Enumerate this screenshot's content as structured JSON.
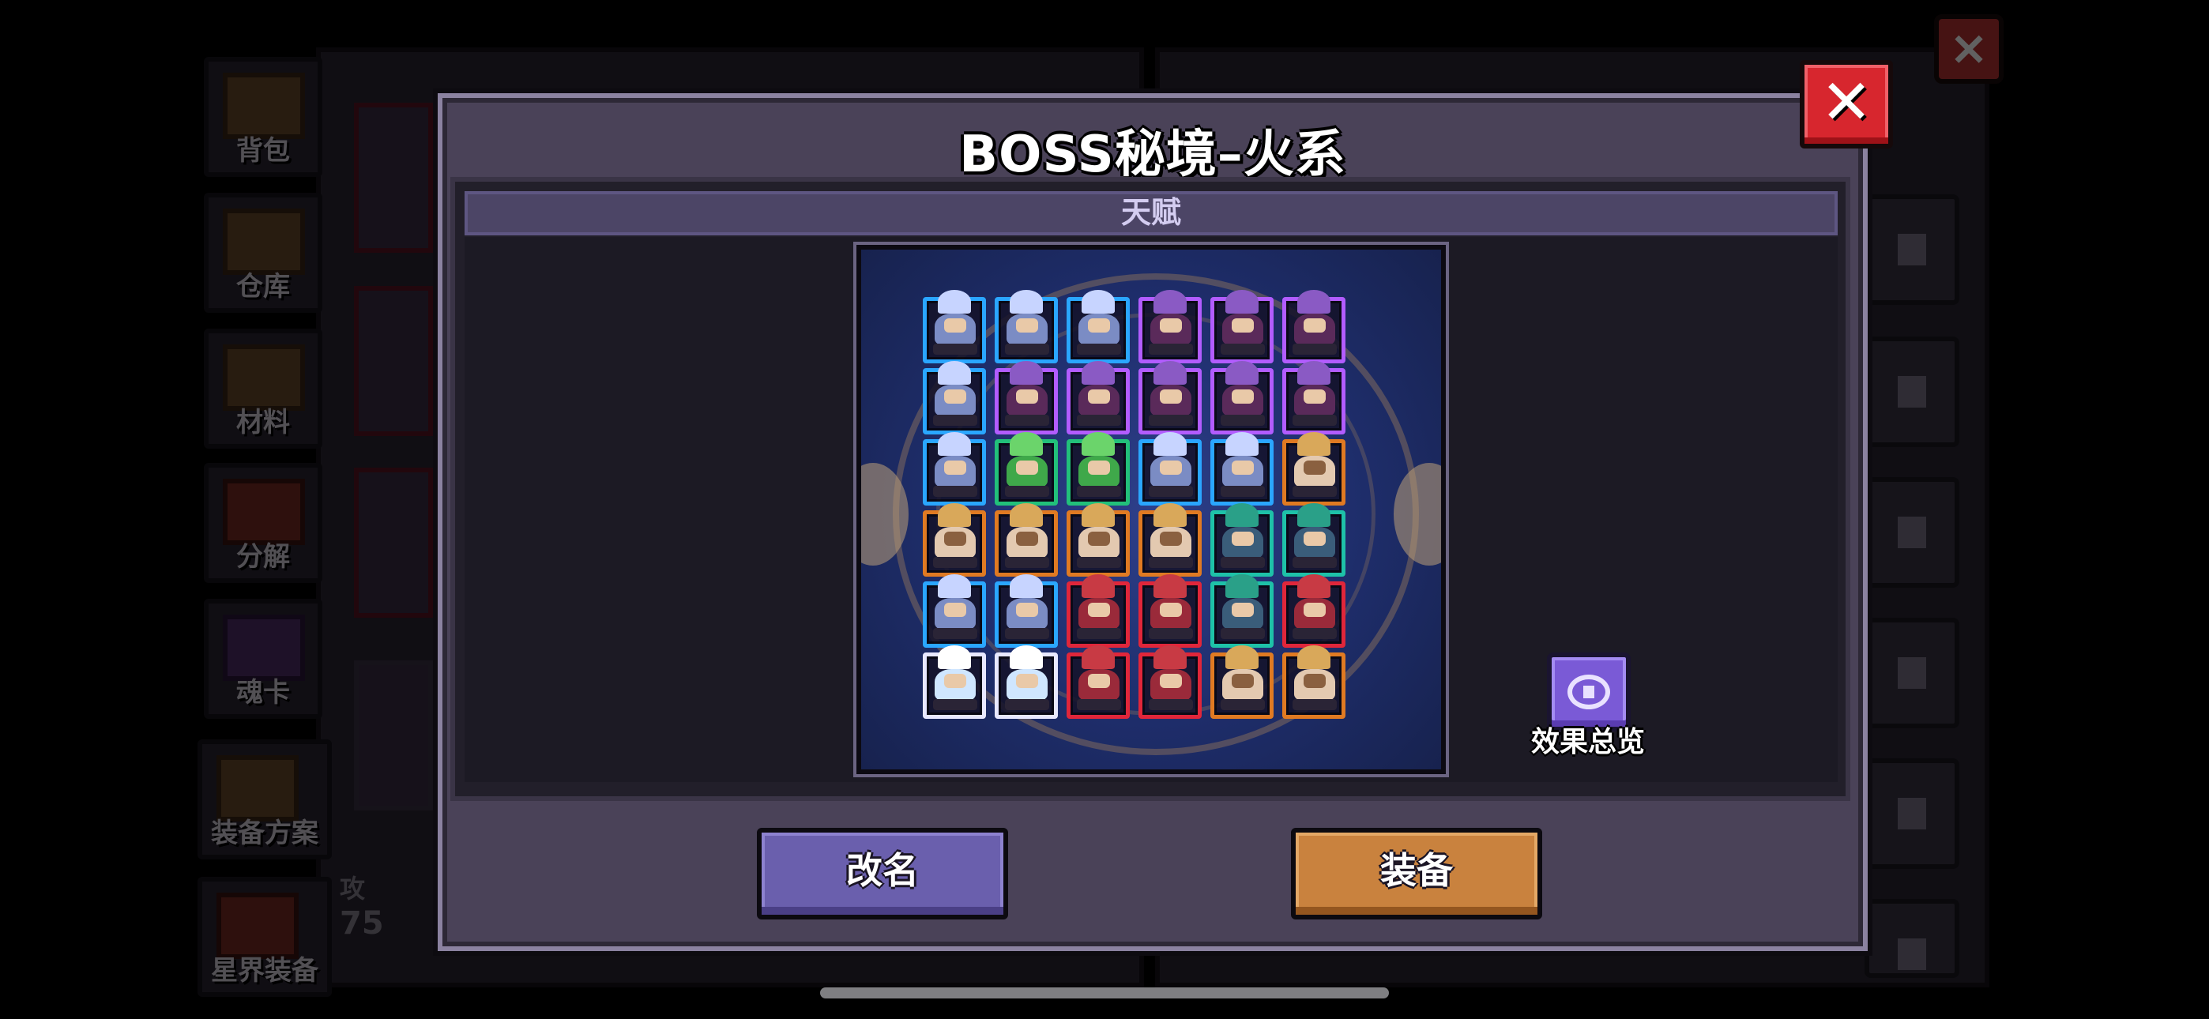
{
  "background": {
    "side_tabs": [
      {
        "label": "背包",
        "icon": "chest-icon"
      },
      {
        "label": "仓库",
        "icon": "warehouse-icon"
      },
      {
        "label": "材料",
        "icon": "materials-icon"
      },
      {
        "label": "分解",
        "icon": "decompose-icon"
      },
      {
        "label": "魂卡",
        "icon": "soul-card-icon"
      },
      {
        "label": "装备方案",
        "icon": "equipment-plan-icon"
      },
      {
        "label": "星界装备",
        "icon": "astral-equipment-icon"
      }
    ],
    "stat_label": "攻",
    "stat_value": "75",
    "close_icon": "close-icon"
  },
  "dialog": {
    "title": "BOSS秘境–火系",
    "close_icon": "close-icon",
    "section_title": "天赋",
    "overview_label": "效果总览",
    "overview_icon": "eye-icon",
    "rename_label": "改名",
    "equip_label": "装备"
  },
  "colors": {
    "blue": "#2aa6ff",
    "purple": "#b25cff",
    "green": "#22c07a",
    "orange": "#e07a22",
    "teal": "#1ec2a8",
    "red": "#e0263a",
    "white": "#e8e8ff"
  },
  "talent_grid": [
    [
      "blue",
      "blue",
      "blue",
      "purple",
      "purple",
      "purple"
    ],
    [
      "blue",
      "purple",
      "purple",
      "purple",
      "purple",
      "purple"
    ],
    [
      "blue",
      "green",
      "green",
      "blue",
      "blue",
      "orange"
    ],
    [
      "orange",
      "orange",
      "orange",
      "orange",
      "teal",
      "teal"
    ],
    [
      "blue",
      "blue",
      "red",
      "red",
      "teal",
      "red"
    ],
    [
      "white",
      "white",
      "red",
      "red",
      "orange",
      "orange"
    ]
  ]
}
